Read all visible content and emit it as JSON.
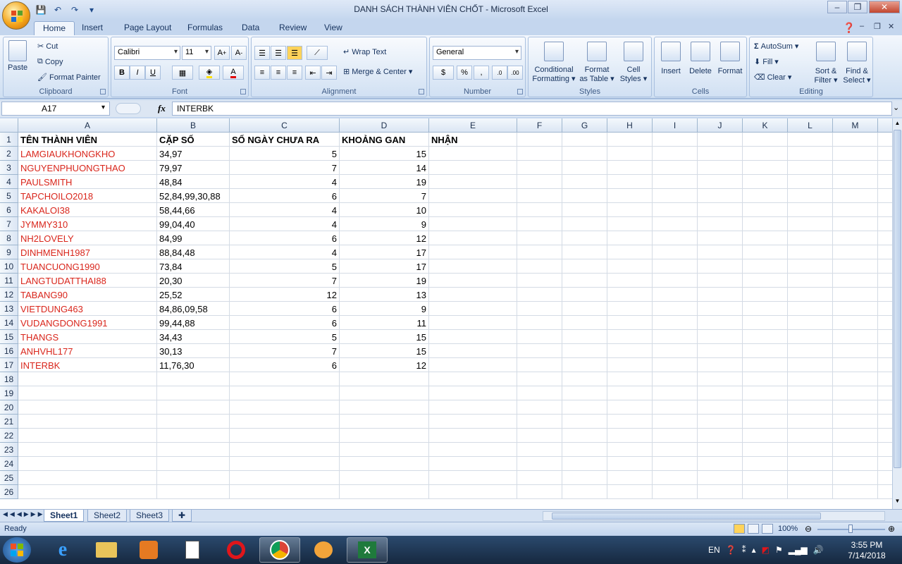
{
  "window": {
    "title": "DANH SÁCH THÀNH VIÊN CHỐT - Microsoft Excel",
    "controls": {
      "minimize": "–",
      "restore": "❐",
      "close": "✕"
    }
  },
  "ribbon": {
    "tabs": [
      "Home",
      "Insert",
      "Page Layout",
      "Formulas",
      "Data",
      "Review",
      "View"
    ],
    "active_tab": "Home",
    "clipboard": {
      "label": "Clipboard",
      "paste": "Paste",
      "cut": "Cut",
      "copy": "Copy",
      "format_painter": "Format Painter"
    },
    "font": {
      "label": "Font",
      "family": "Calibri",
      "size": "11",
      "bold": "B",
      "italic": "I",
      "underline": "U"
    },
    "alignment": {
      "label": "Alignment",
      "wrap_text": "Wrap Text",
      "merge_center": "Merge & Center"
    },
    "number": {
      "label": "Number",
      "format": "General",
      "currency": "$",
      "percent": "%",
      "comma": ","
    },
    "styles": {
      "label": "Styles",
      "conditional": "Conditional",
      "conditional2": "Formatting",
      "format_table": "Format",
      "format_table2": "as Table",
      "cell_styles": "Cell",
      "cell_styles2": "Styles"
    },
    "cells": {
      "label": "Cells",
      "insert": "Insert",
      "delete": "Delete",
      "format": "Format"
    },
    "editing": {
      "label": "Editing",
      "autosum": "AutoSum",
      "fill": "Fill",
      "clear": "Clear",
      "sort": "Sort &",
      "sort2": "Filter",
      "find": "Find &",
      "find2": "Select"
    }
  },
  "formula_bar": {
    "name_box": "A17",
    "fx": "fx",
    "value": "INTERBK"
  },
  "columns": [
    "A",
    "B",
    "C",
    "D",
    "E",
    "F",
    "G",
    "H",
    "I",
    "J",
    "K",
    "L",
    "M"
  ],
  "sheet": {
    "headers": [
      "TÊN THÀNH VIÊN",
      "CẶP SỐ",
      "SỐ NGÀY CHƯA RA",
      "KHOẢNG GAN",
      "NHẬN"
    ],
    "rows": [
      [
        "LAMGIAUKHONGKHO",
        "34,97",
        "5",
        "15"
      ],
      [
        "NGUYENPHUONGTHAO",
        "79,97",
        "7",
        "14"
      ],
      [
        "PAULSMITH",
        "48,84",
        "4",
        "19"
      ],
      [
        "TAPCHOILO2018",
        "52,84,99,30,88",
        "6",
        "7"
      ],
      [
        "KAKALOI38",
        "58,44,66",
        "4",
        "10"
      ],
      [
        "JYMMY310",
        "99,04,40",
        "4",
        "9"
      ],
      [
        "NH2LOVELY",
        "84,99",
        "6",
        "12"
      ],
      [
        "DINHMENH1987",
        "88,84,48",
        "4",
        "17"
      ],
      [
        "TUANCUONG1990",
        "73,84",
        "5",
        "17"
      ],
      [
        "LANGTUDATTHAI88",
        "20,30",
        "7",
        "19"
      ],
      [
        "TABANG90",
        "25,52",
        "12",
        "13"
      ],
      [
        "VIETDUNG463",
        "84,86,09,58",
        "6",
        "9"
      ],
      [
        "VUDANGDONG1991",
        "99,44,88",
        "6",
        "11"
      ],
      [
        "THANGS",
        "34,43",
        "5",
        "15"
      ],
      [
        "ANHVHL177",
        "30,13",
        "7",
        "15"
      ],
      [
        "INTERBK",
        "11,76,30",
        "6",
        "12"
      ]
    ],
    "row_numbers": [
      "1",
      "2",
      "3",
      "4",
      "5",
      "6",
      "7",
      "8",
      "9",
      "10",
      "11",
      "12",
      "13",
      "14",
      "15",
      "16",
      "17",
      "18",
      "19",
      "20",
      "21",
      "22",
      "23",
      "24",
      "25",
      "26"
    ]
  },
  "sheet_tabs": [
    "Sheet1",
    "Sheet2",
    "Sheet3"
  ],
  "active_sheet": "Sheet1",
  "status": {
    "ready": "Ready",
    "zoom": "100%"
  },
  "taskbar": {
    "lang": "EN",
    "time": "3:55 PM",
    "date": "7/14/2018"
  },
  "colors": {
    "name_text": "#d9261c",
    "header_bg": "#dbe6f4",
    "excel_green": "#1f7a3c"
  }
}
